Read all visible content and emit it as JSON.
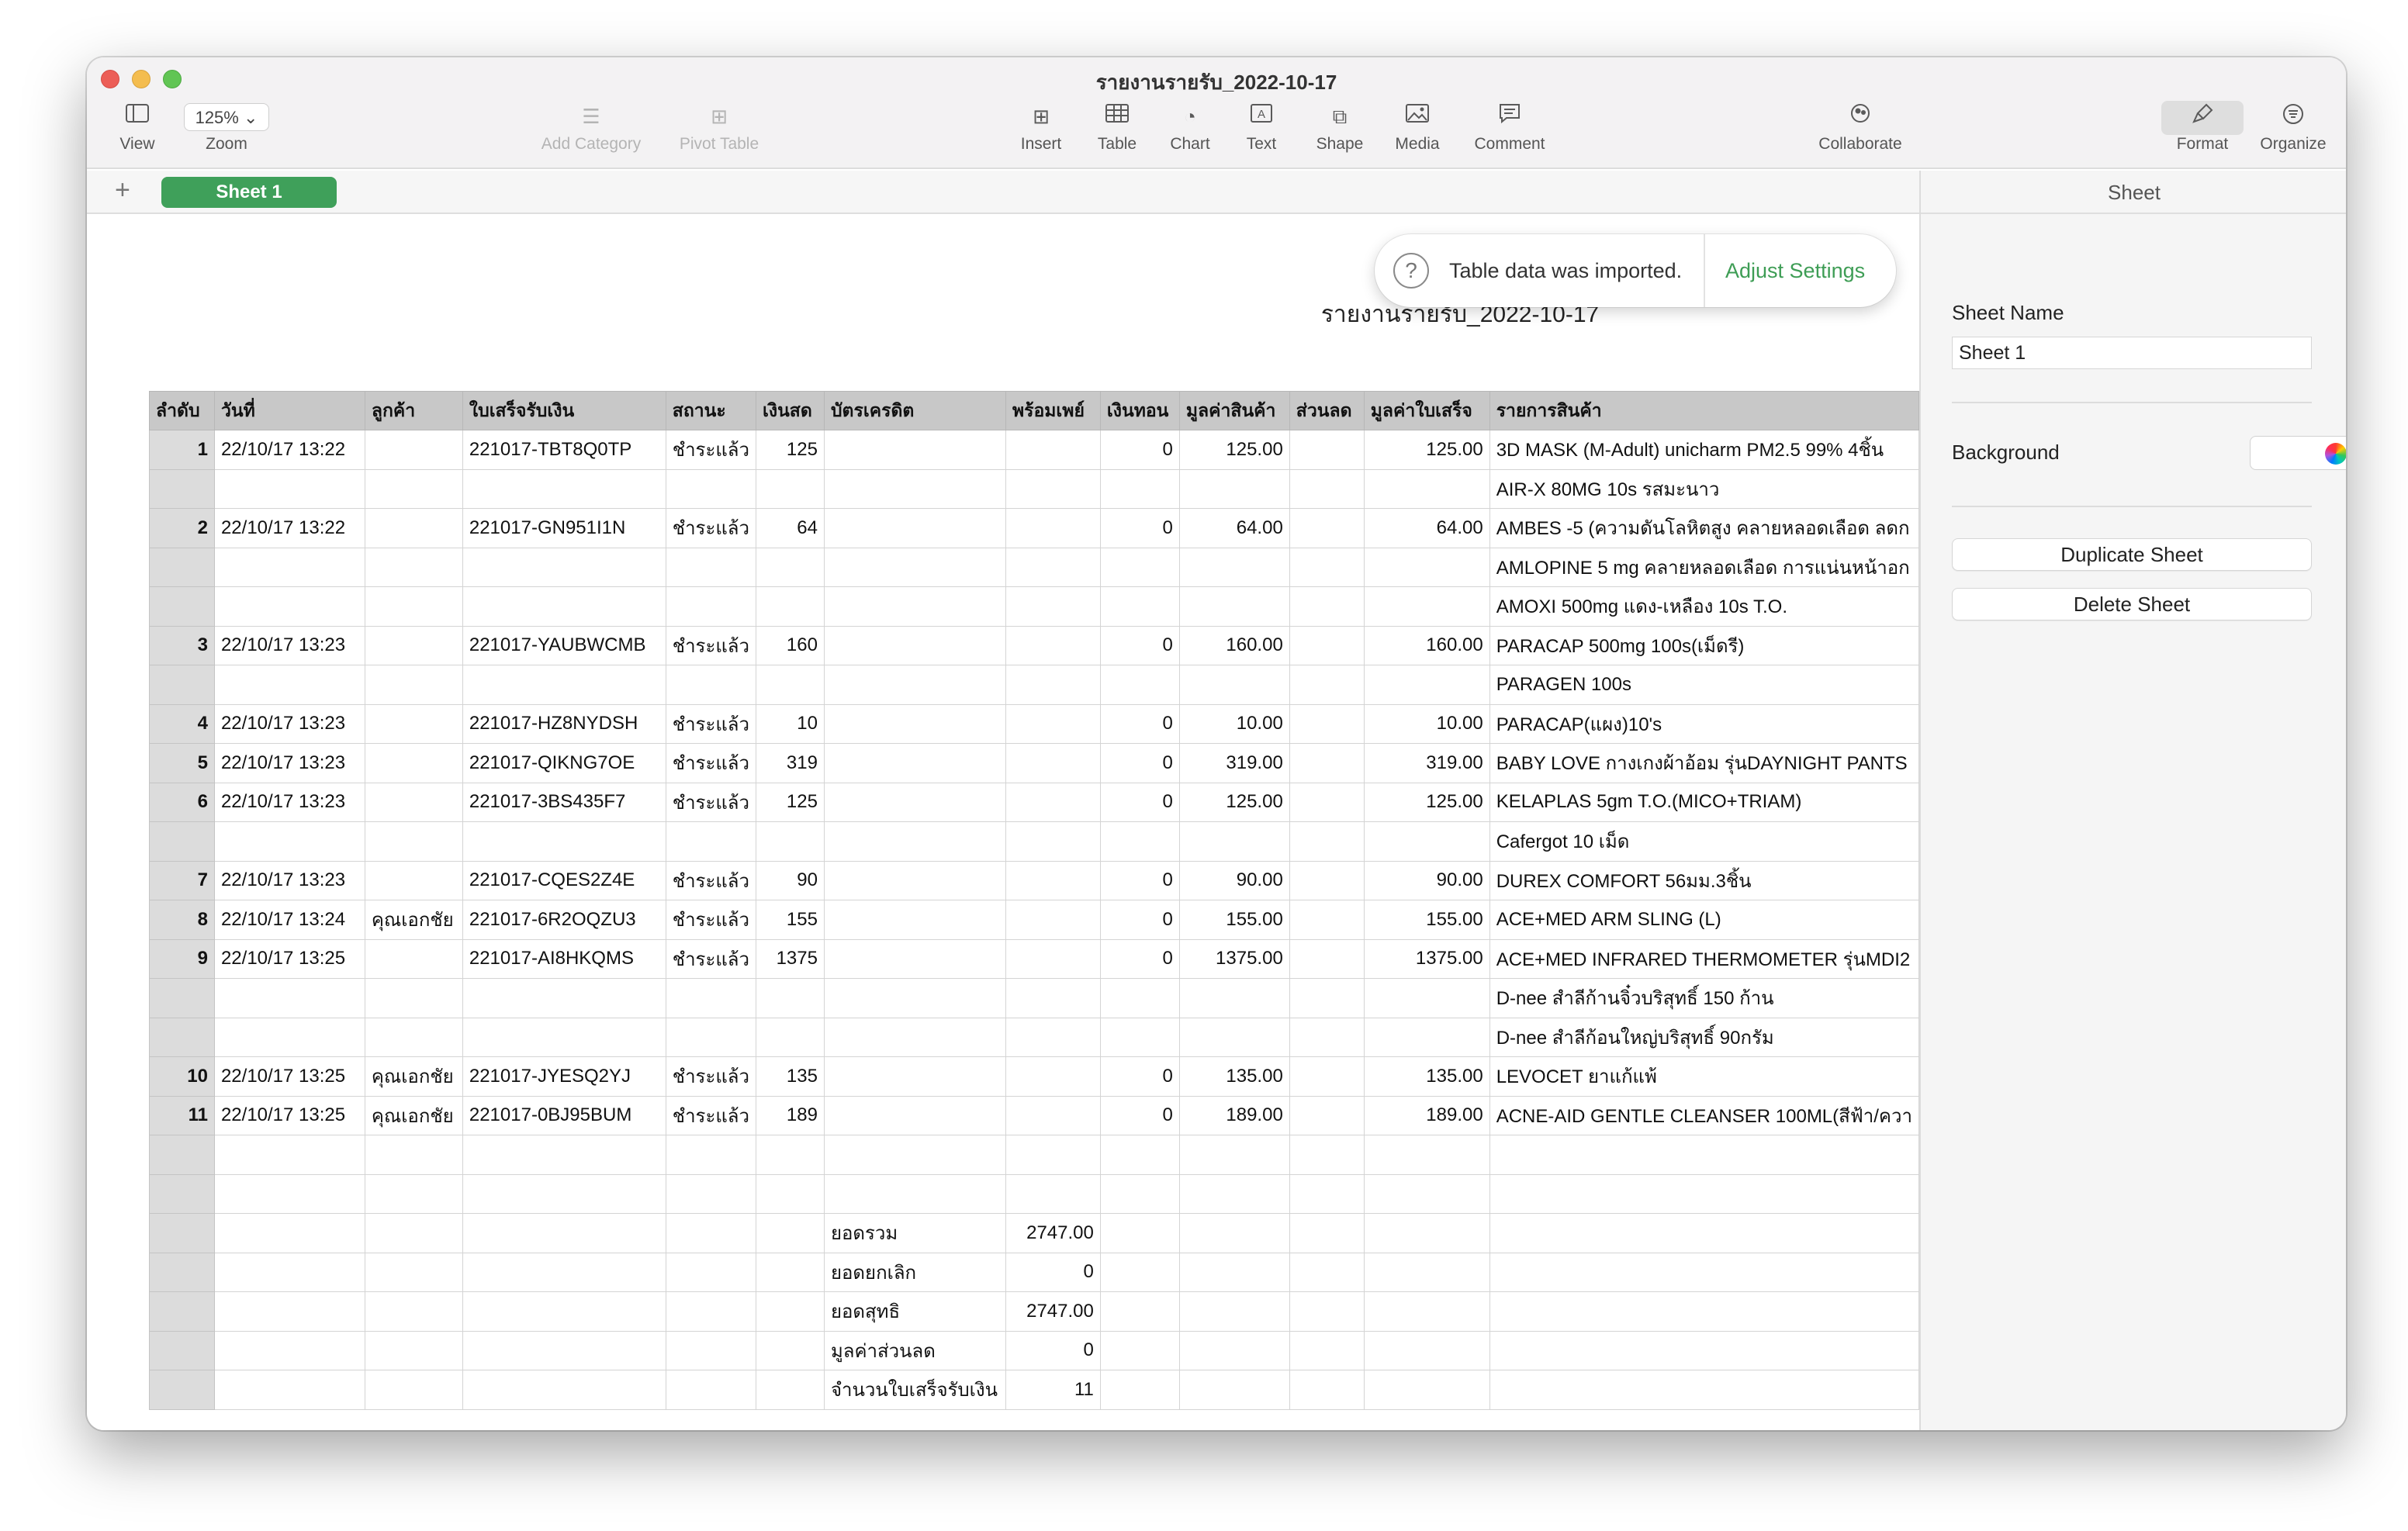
{
  "window": {
    "title": "รายงานรายรับ_2022-10-17"
  },
  "toolbar": {
    "view_label": "View",
    "zoom_value": "125%",
    "zoom_label": "Zoom",
    "add_category_label": "Add Category",
    "pivot_table_label": "Pivot Table",
    "insert_label": "Insert",
    "table_label": "Table",
    "chart_label": "Chart",
    "text_label": "Text",
    "shape_label": "Shape",
    "media_label": "Media",
    "comment_label": "Comment",
    "collaborate_label": "Collaborate",
    "format_label": "Format",
    "organize_label": "Organize"
  },
  "tabs": {
    "add": "+",
    "sheet1": "Sheet 1"
  },
  "notification": {
    "message": "Table data was imported.",
    "action": "Adjust Settings"
  },
  "report": {
    "title": "รายงานรายรับ_2022-10-17"
  },
  "table": {
    "headers": [
      "ลำดับ",
      "วันที่",
      "ลูกค้า",
      "ใบเสร็จรับเงิน",
      "สถานะ",
      "เงินสด",
      "บัตรเครดิต",
      "พร้อมเพย์",
      "เงินทอน",
      "มูลค่าสินค้า",
      "ส่วนลด",
      "มูลค่าใบเสร็จ",
      "รายการสินค้า"
    ],
    "rows": [
      [
        "1",
        "22/10/17 13:22",
        "",
        "221017-TBT8Q0TP",
        "ชำระแล้ว",
        "125",
        "",
        "",
        "0",
        "125.00",
        "",
        "125.00",
        "3D MASK (M-Adult) unicharm PM2.5 99% 4ชิ้น"
      ],
      [
        "",
        "",
        "",
        "",
        "",
        "",
        "",
        "",
        "",
        "",
        "",
        "",
        "AIR-X 80MG 10s รสมะนาว"
      ],
      [
        "2",
        "22/10/17 13:22",
        "",
        "221017-GN951I1N",
        "ชำระแล้ว",
        "64",
        "",
        "",
        "0",
        "64.00",
        "",
        "64.00",
        "AMBES -5 (ความดันโลหิตสูง คลายหลอดเลือด ลดก"
      ],
      [
        "",
        "",
        "",
        "",
        "",
        "",
        "",
        "",
        "",
        "",
        "",
        "",
        "AMLOPINE 5 mg คลายหลอดเลือด การแน่นหน้าอก"
      ],
      [
        "",
        "",
        "",
        "",
        "",
        "",
        "",
        "",
        "",
        "",
        "",
        "",
        "AMOXI 500mg แดง-เหลือง 10s T.O."
      ],
      [
        "3",
        "22/10/17 13:23",
        "",
        "221017-YAUBWCMB",
        "ชำระแล้ว",
        "160",
        "",
        "",
        "0",
        "160.00",
        "",
        "160.00",
        "PARACAP 500mg 100s(เม็ดรี)"
      ],
      [
        "",
        "",
        "",
        "",
        "",
        "",
        "",
        "",
        "",
        "",
        "",
        "",
        "PARAGEN 100s"
      ],
      [
        "4",
        "22/10/17 13:23",
        "",
        "221017-HZ8NYDSH",
        "ชำระแล้ว",
        "10",
        "",
        "",
        "0",
        "10.00",
        "",
        "10.00",
        "PARACAP(แผง)10's"
      ],
      [
        "5",
        "22/10/17 13:23",
        "",
        "221017-QIKNG7OE",
        "ชำระแล้ว",
        "319",
        "",
        "",
        "0",
        "319.00",
        "",
        "319.00",
        "BABY LOVE กางเกงผ้าอ้อม รุ่นDAYNIGHT PANTS"
      ],
      [
        "6",
        "22/10/17 13:23",
        "",
        "221017-3BS435F7",
        "ชำระแล้ว",
        "125",
        "",
        "",
        "0",
        "125.00",
        "",
        "125.00",
        "KELAPLAS 5gm T.O.(MICO+TRIAM)"
      ],
      [
        "",
        "",
        "",
        "",
        "",
        "",
        "",
        "",
        "",
        "",
        "",
        "",
        "Cafergot 10 เม็ด"
      ],
      [
        "7",
        "22/10/17 13:23",
        "",
        "221017-CQES2Z4E",
        "ชำระแล้ว",
        "90",
        "",
        "",
        "0",
        "90.00",
        "",
        "90.00",
        "DUREX COMFORT 56มม.3ชิ้น"
      ],
      [
        "8",
        "22/10/17 13:24",
        "คุณเอกชัย",
        "221017-6R2OQZU3",
        "ชำระแล้ว",
        "155",
        "",
        "",
        "0",
        "155.00",
        "",
        "155.00",
        "ACE+MED ARM SLING (L)"
      ],
      [
        "9",
        "22/10/17 13:25",
        "",
        "221017-AI8HKQMS",
        "ชำระแล้ว",
        "1375",
        "",
        "",
        "0",
        "1375.00",
        "",
        "1375.00",
        "ACE+MED INFRARED THERMOMETER รุ่นMDI2"
      ],
      [
        "",
        "",
        "",
        "",
        "",
        "",
        "",
        "",
        "",
        "",
        "",
        "",
        "D-nee สำลีก้านจิ๋วบริสุทธิ์ 150 ก้าน"
      ],
      [
        "",
        "",
        "",
        "",
        "",
        "",
        "",
        "",
        "",
        "",
        "",
        "",
        "D-nee สำลีก้อนใหญ่บริสุทธิ์ 90กรัม"
      ],
      [
        "10",
        "22/10/17 13:25",
        "คุณเอกชัย",
        "221017-JYESQ2YJ",
        "ชำระแล้ว",
        "135",
        "",
        "",
        "0",
        "135.00",
        "",
        "135.00",
        "LEVOCET ยาแก้แพ้"
      ],
      [
        "11",
        "22/10/17 13:25",
        "คุณเอกชัย",
        "221017-0BJ95BUM",
        "ชำระแล้ว",
        "189",
        "",
        "",
        "0",
        "189.00",
        "",
        "189.00",
        "ACNE-AID GENTLE CLEANSER 100ML(สีฟ้า/ควา"
      ],
      [
        "",
        "",
        "",
        "",
        "",
        "",
        "",
        "",
        "",
        "",
        "",
        "",
        ""
      ],
      [
        "",
        "",
        "",
        "",
        "",
        "",
        "",
        "",
        "",
        "",
        "",
        "",
        ""
      ],
      [
        "",
        "",
        "",
        "",
        "",
        "",
        "ยอดรวม",
        "2747.00",
        "",
        "",
        "",
        "",
        ""
      ],
      [
        "",
        "",
        "",
        "",
        "",
        "",
        "ยอดยกเลิก",
        "0",
        "",
        "",
        "",
        "",
        ""
      ],
      [
        "",
        "",
        "",
        "",
        "",
        "",
        "ยอดสุทธิ",
        "2747.00",
        "",
        "",
        "",
        "",
        ""
      ],
      [
        "",
        "",
        "",
        "",
        "",
        "",
        "มูลค่าส่วนลด",
        "0",
        "",
        "",
        "",
        "",
        ""
      ],
      [
        "",
        "",
        "",
        "",
        "",
        "",
        "จำนวนใบเสร็จรับเงิน",
        "11",
        "",
        "",
        "",
        "",
        ""
      ]
    ]
  },
  "sidebar": {
    "title": "Sheet",
    "sheet_name_label": "Sheet Name",
    "sheet_name_value": "Sheet 1",
    "background_label": "Background",
    "duplicate_label": "Duplicate Sheet",
    "delete_label": "Delete Sheet"
  }
}
